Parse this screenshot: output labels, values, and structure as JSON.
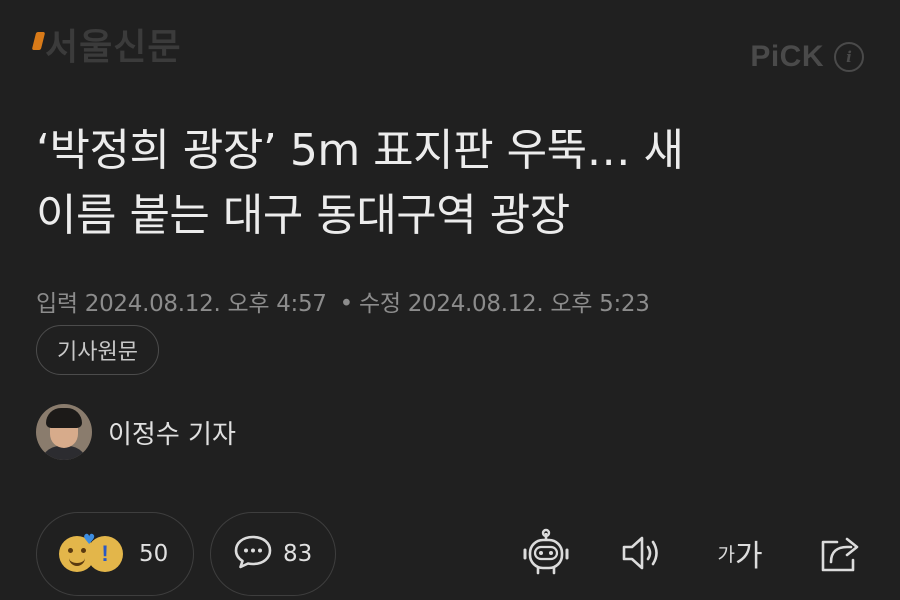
{
  "header": {
    "press_name": "서울신문",
    "pick_label": "PiCK",
    "info_icon": "info-icon"
  },
  "article": {
    "title_line1": "‘박정희 광장’ 5m 표지판 우뚝… 새",
    "title_line2": "이름 붙는 대구 동대구역 광장",
    "meta": {
      "input_label": "입력",
      "input_datetime": "2024.08.12. 오후 4:57",
      "separator": "•",
      "modified_label": "수정",
      "modified_datetime": "2024.08.12. 오후 5:23"
    },
    "origin_button_label": "기사원문",
    "reporter_name": "이정수 기자"
  },
  "toolbar": {
    "reaction_count": "50",
    "comment_count": "83",
    "font_size_small": "가",
    "font_size_large": "가",
    "icons": [
      "reaction-emoji-icon",
      "comment-icon",
      "robot-summary-icon",
      "speaker-icon",
      "font-size-icon",
      "share-icon"
    ]
  },
  "colors": {
    "background": "#202020",
    "logo_accent": "#d87a18",
    "text_primary": "#ececec",
    "text_secondary": "#8c8c8c"
  }
}
